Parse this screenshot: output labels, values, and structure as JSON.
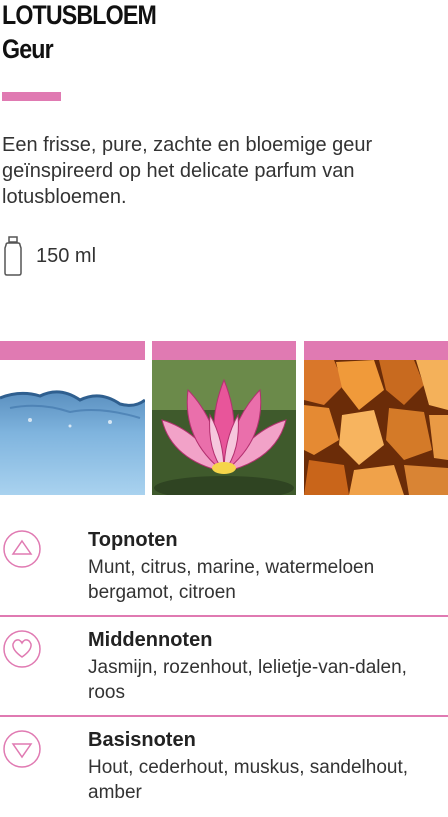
{
  "header": {
    "title": "LOTUSBLOEM",
    "subtitle": "Geur"
  },
  "description": "Een frisse, pure, zachte en bloemige geur geïnspireerd op het delicate parfum van lotusbloemen.",
  "volume": {
    "icon": "bottle-icon",
    "value": "150 ml"
  },
  "images": [
    {
      "name": "water-image"
    },
    {
      "name": "lotus-flower-image"
    },
    {
      "name": "amber-image"
    }
  ],
  "notes": [
    {
      "icon": "triangle-up-icon",
      "title": "Topnoten",
      "text": "Munt, citrus, marine, watermeloen bergamot, citroen"
    },
    {
      "icon": "heart-icon",
      "title": "Middennoten",
      "text": "Jasmijn, rozenhout, lelietje-van-dalen, roos"
    },
    {
      "icon": "triangle-down-icon",
      "title": "Basisnoten",
      "text": "Hout, cederhout, muskus, sandelhout, amber"
    }
  ],
  "colors": {
    "accent": "#e07ab2",
    "text": "#333333"
  }
}
